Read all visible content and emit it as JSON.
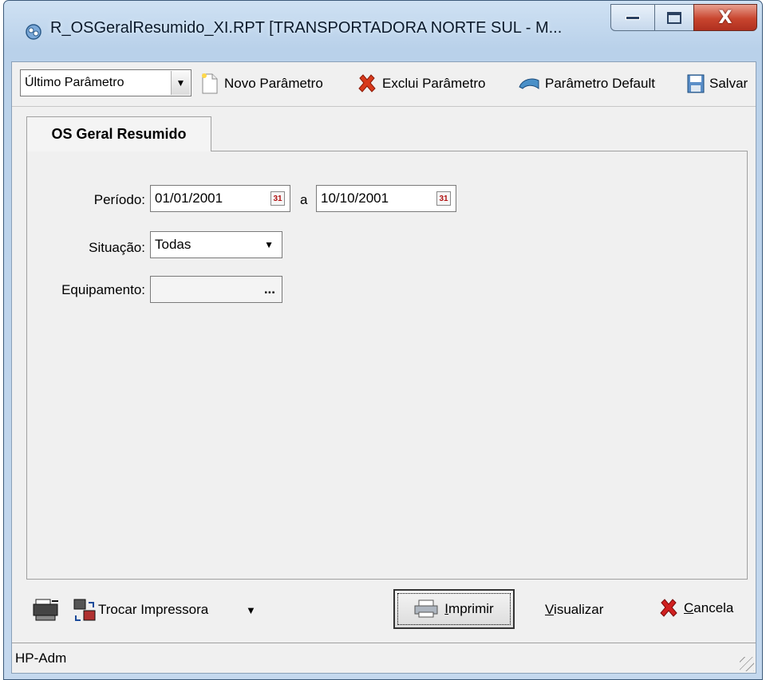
{
  "window": {
    "title": "R_OSGeralResumido_XI.RPT [TRANSPORTADORA NORTE SUL -  M...",
    "controls": {
      "minimize_icon": "minimize-icon",
      "maximize_icon": "maximize-icon",
      "close_label": "X"
    }
  },
  "toolbar": {
    "param_combo": {
      "value": "Último Parâmetro"
    },
    "new_param": "Novo Parâmetro",
    "delete_param": "Exclui Parâmetro",
    "default_param": "Parâmetro Default",
    "save": "Salvar"
  },
  "tabs": [
    {
      "label": "OS Geral Resumido",
      "active": true
    }
  ],
  "form": {
    "periodo": {
      "label": "Período:",
      "start": "01/01/2001",
      "separator": "a",
      "end": "10/10/2001"
    },
    "situacao": {
      "label": "Situação:",
      "value": "Todas"
    },
    "equipamento": {
      "label": "Equipamento:",
      "value": "",
      "button": "..."
    }
  },
  "bottom": {
    "trocar_impressora": "Trocar Impressora",
    "imprimir_prefix": "I",
    "imprimir_rest": "mprimir",
    "visualizar_prefix": "V",
    "visualizar_rest": "isualizar",
    "cancela_prefix": "C",
    "cancela_rest": "ancela"
  },
  "status": {
    "printer": "HP-Adm"
  },
  "colors": {
    "close_button": "#c8452e",
    "title_bar": "#b9d1ea",
    "client_bg": "#f0f0f0",
    "cancel_x": "#d02020",
    "delete_x": "#d83a1c"
  }
}
